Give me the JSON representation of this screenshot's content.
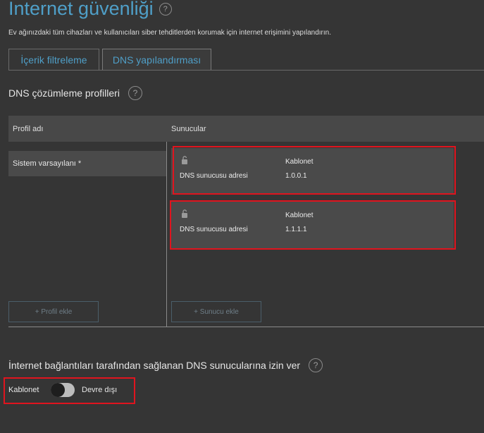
{
  "page": {
    "title": "İnternet güvenliği",
    "subtitle": "Ev ağınızdaki tüm cihazları ve kullanıcıları siber tehditlerden korumak için internet erişimini yapılandırın."
  },
  "tabs": [
    {
      "label": "İçerik filtreleme",
      "active": false
    },
    {
      "label": "DNS yapılandırması",
      "active": true
    }
  ],
  "dns_profiles": {
    "title": "DNS çözümleme profilleri",
    "columns": {
      "profile": "Profil adı",
      "servers": "Sunucular"
    },
    "profiles": [
      {
        "name": "Sistem varsayılanı *"
      }
    ],
    "servers": [
      {
        "provider": "Kablonet",
        "label": "DNS sunucusu adresi",
        "address": "1.0.0.1",
        "icon": "unlock-icon"
      },
      {
        "provider": "Kablonet",
        "label": "DNS sunucusu adresi",
        "address": "1.1.1.1",
        "icon": "unlock-icon"
      }
    ],
    "add_profile_label": "+ Profil ekle",
    "add_server_label": "+ Sunucu ekle"
  },
  "allow_isp_dns": {
    "title": "İnternet bağlantıları tarafından sağlanan DNS sunucularına izin ver",
    "connection_label": "Kablonet",
    "state_label": "Devre dışı",
    "enabled": false
  },
  "colors": {
    "accent": "#4f9fc8",
    "highlight": "#e0141e",
    "background": "#353535"
  }
}
